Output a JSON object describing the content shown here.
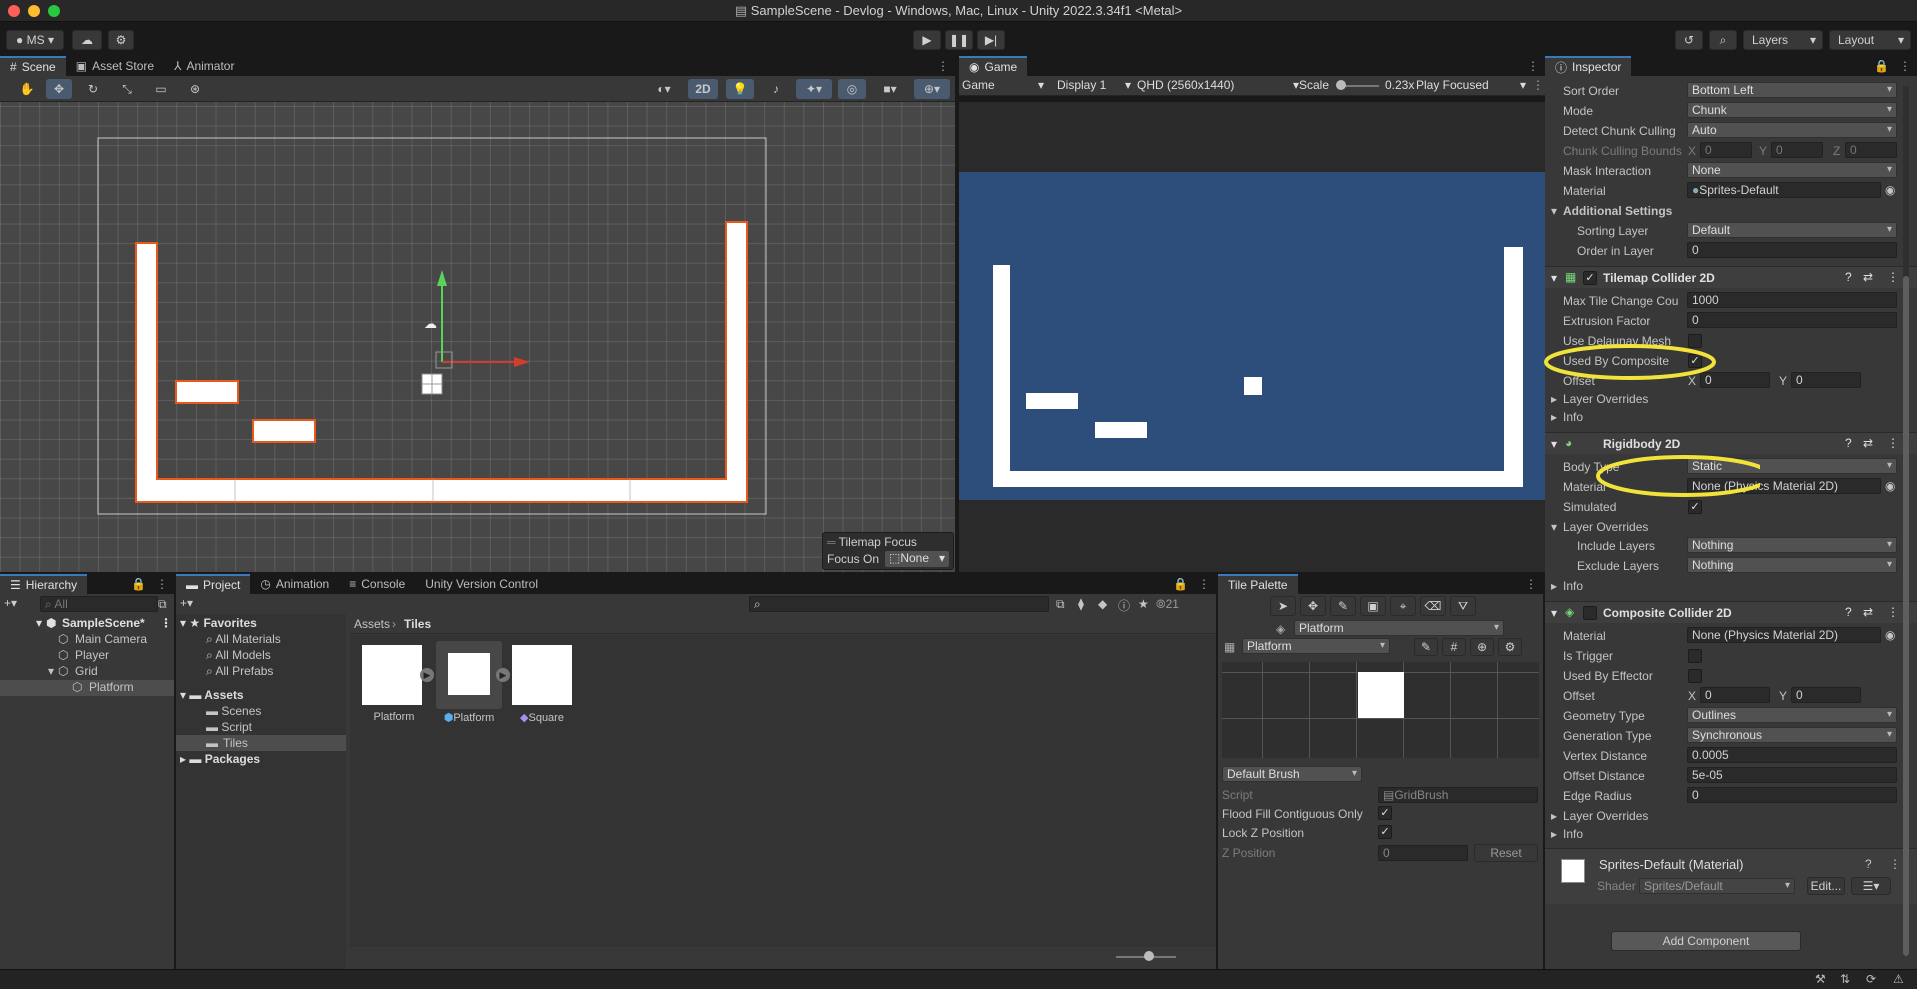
{
  "window": {
    "title": "SampleScene - Devlog - Windows, Mac, Linux - Unity 2022.3.34f1 <Metal>"
  },
  "toolbar": {
    "account": "MS",
    "layers_label": "Layers",
    "layout_label": "Layout"
  },
  "scene_panel": {
    "tabs": [
      "Scene",
      "Asset Store",
      "Animator"
    ],
    "mode_2d": "2D",
    "overlay_title": "Tilemap Focus",
    "focus_on_label": "Focus On",
    "focus_on_value": "None"
  },
  "game_panel": {
    "tab": "Game",
    "mode": "Game",
    "display": "Display 1",
    "resolution": "QHD (2560x1440)",
    "scale_label": "Scale",
    "scale_value": "0.23x",
    "scale_level": 0.05,
    "play_mode": "Play Focused",
    "bg_color": "#2d4e7a"
  },
  "inspector": {
    "tab": "Inspector",
    "sort_order": {
      "label": "Sort Order",
      "value": "Bottom Left"
    },
    "mode": {
      "label": "Mode",
      "value": "Chunk"
    },
    "detect_culling": {
      "label": "Detect Chunk Culling",
      "value": "Auto"
    },
    "culling_bounds": {
      "label": "Chunk Culling Bounds",
      "x": "0",
      "y": "0",
      "z": "0"
    },
    "mask_interaction": {
      "label": "Mask Interaction",
      "value": "None"
    },
    "material": {
      "label": "Material",
      "value": "Sprites-Default"
    },
    "additional_settings": "Additional Settings",
    "sorting_layer": {
      "label": "Sorting Layer",
      "value": "Default"
    },
    "order_in_layer": {
      "label": "Order in Layer",
      "value": "0"
    },
    "tilemap_collider": {
      "title": "Tilemap Collider 2D",
      "max_tile_change": {
        "label": "Max Tile Change Cou",
        "value": "1000"
      },
      "extrusion": {
        "label": "Extrusion Factor",
        "value": "0"
      },
      "delaunay": {
        "label": "Use Delaunay Mesh"
      },
      "used_by_composite": {
        "label": "Used By Composite"
      },
      "offset": {
        "label": "Offset",
        "x": "0",
        "y": "0"
      },
      "layer_overrides": "Layer Overrides",
      "info": "Info"
    },
    "rigidbody": {
      "title": "Rigidbody 2D",
      "body_type": {
        "label": "Body Type",
        "value": "Static"
      },
      "material": {
        "label": "Material",
        "value": "None (Physics Material 2D)"
      },
      "simulated": {
        "label": "Simulated"
      },
      "layer_overrides": "Layer Overrides",
      "include_layers": {
        "label": "Include Layers",
        "value": "Nothing"
      },
      "exclude_layers": {
        "label": "Exclude Layers",
        "value": "Nothing"
      },
      "info": "Info"
    },
    "composite": {
      "title": "Composite Collider 2D",
      "material": {
        "label": "Material",
        "value": "None (Physics Material 2D)"
      },
      "is_trigger": {
        "label": "Is Trigger"
      },
      "used_by_effector": {
        "label": "Used By Effector"
      },
      "offset": {
        "label": "Offset",
        "x": "0",
        "y": "0"
      },
      "geometry_type": {
        "label": "Geometry Type",
        "value": "Outlines"
      },
      "generation_type": {
        "label": "Generation Type",
        "value": "Synchronous"
      },
      "vertex_distance": {
        "label": "Vertex Distance",
        "value": "0.0005"
      },
      "offset_distance": {
        "label": "Offset Distance",
        "value": "5e-05"
      },
      "edge_radius": {
        "label": "Edge Radius",
        "value": "0"
      },
      "layer_overrides": "Layer Overrides",
      "info": "Info"
    },
    "material_block": {
      "name": "Sprites-Default (Material)",
      "shader_label": "Shader",
      "shader_value": "Sprites/Default",
      "edit": "Edit..."
    },
    "add_component": "Add Component",
    "highlight_color": "#f2e33a"
  },
  "hierarchy": {
    "tab": "Hierarchy",
    "search_placeholder": "All",
    "items": [
      "SampleScene*",
      "Main Camera",
      "Player",
      "Grid",
      "Platform"
    ]
  },
  "project": {
    "tabs": [
      "Project",
      "Animation",
      "Console",
      "Unity Version Control"
    ],
    "hidden_count": "21",
    "favorites_label": "Favorites",
    "favorites": [
      "All Materials",
      "All Models",
      "All Prefabs"
    ],
    "assets_label": "Assets",
    "asset_folders": [
      "Scenes",
      "Script",
      "Tiles"
    ],
    "packages_label": "Packages",
    "breadcrumb": [
      "Assets",
      "Tiles"
    ],
    "files": [
      "Platform",
      "Platform",
      "Square"
    ]
  },
  "tile_palette": {
    "tab": "Tile Palette",
    "target": "Platform",
    "palette": "Platform",
    "brush": "Default Brush",
    "script_label": "Script",
    "script_value": "GridBrush",
    "flood_fill": "Flood Fill Contiguous Only",
    "lock_z": "Lock Z Position",
    "z_position_label": "Z Position",
    "z_position_value": "0",
    "reset": "Reset"
  }
}
